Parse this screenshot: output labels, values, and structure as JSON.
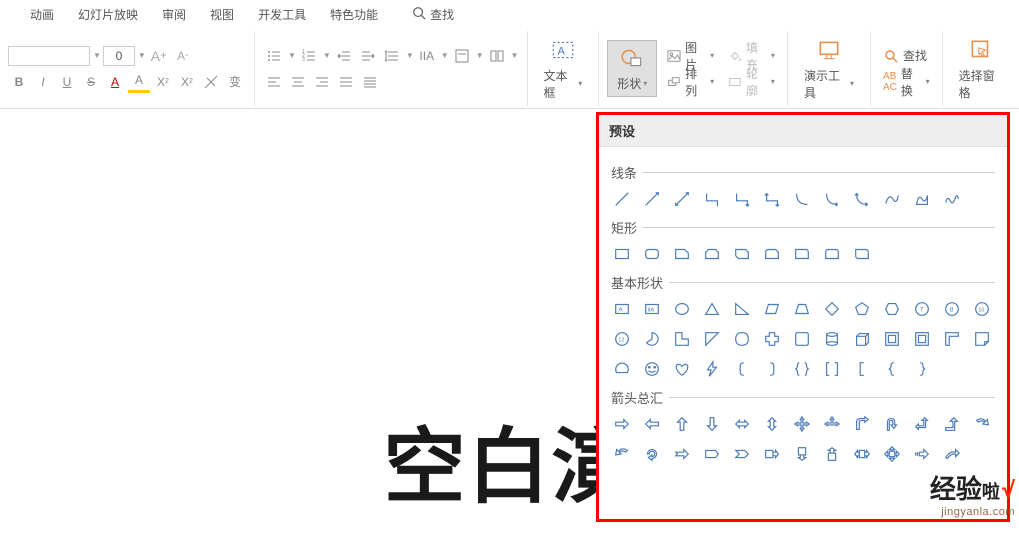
{
  "tabs": {
    "animation": "动画",
    "slideshow": "幻灯片放映",
    "review": "审阅",
    "view": "视图",
    "devtools": "开发工具",
    "features": "特色功能",
    "search": "查找"
  },
  "ribbon": {
    "font_size_value": "0",
    "textbox": "文本框",
    "shapes": "形状",
    "picture": "图片",
    "arrange": "排列",
    "fill": "填充",
    "outline": "轮廓",
    "demo_tools": "演示工具",
    "find": "查找",
    "replace": "替换",
    "select_pane": "选择窗格"
  },
  "slide": {
    "title": "空白演"
  },
  "shapes_panel": {
    "header": "预设",
    "cat_lines": "线条",
    "cat_rects": "矩形",
    "cat_basic": "基本形状",
    "cat_arrows": "箭头总汇"
  },
  "watermark": {
    "big": "经验",
    "small": "啦",
    "check": "√",
    "url": "jingyanla.com"
  }
}
